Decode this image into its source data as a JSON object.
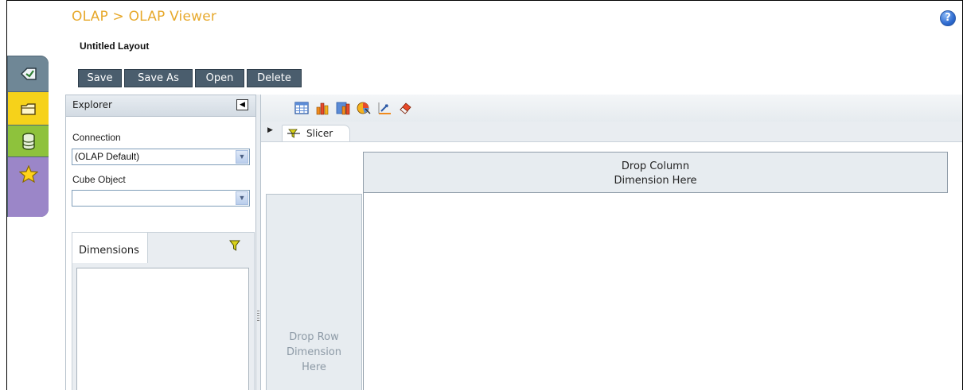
{
  "breadcrumb": "OLAP > OLAP Viewer",
  "help_icon": "?",
  "layout_name": "Untitled Layout",
  "toolbar": {
    "save_label": "Save",
    "save_as_label": "Save As",
    "open_label": "Open",
    "delete_label": "Delete"
  },
  "side_tabs": [
    {
      "icon": "tag-icon",
      "color": "#6f8796"
    },
    {
      "icon": "folder-icon",
      "color": "#f6d21a"
    },
    {
      "icon": "database-icon",
      "color": "#8ec23c"
    },
    {
      "icon": "star-icon",
      "color": "#9b86c8"
    }
  ],
  "explorer": {
    "title": "Explorer",
    "collapse_glyph": "◀",
    "connection_label": "Connection",
    "connection_value": "(OLAP Default)",
    "cube_label": "Cube Object",
    "cube_value": "",
    "dimensions_tab": "Dimensions"
  },
  "view_toolbar_icons": [
    "table-icon",
    "bar-chart-icon",
    "combo-chart-icon",
    "pie-chart-icon",
    "line-chart-icon",
    "eraser-icon"
  ],
  "slicer": {
    "label": "Slicer",
    "caret": "▶"
  },
  "grid": {
    "col_drop_line1": "Drop Column",
    "col_drop_line2": "Dimension Here",
    "row_drop_line1": "Drop Row",
    "row_drop_line2": "Dimension",
    "row_drop_line3": "Here"
  },
  "colors": {
    "breadcrumb": "#e7a92c",
    "button_bg": "#4a5d6d",
    "panel_bg": "#e9edf1"
  }
}
